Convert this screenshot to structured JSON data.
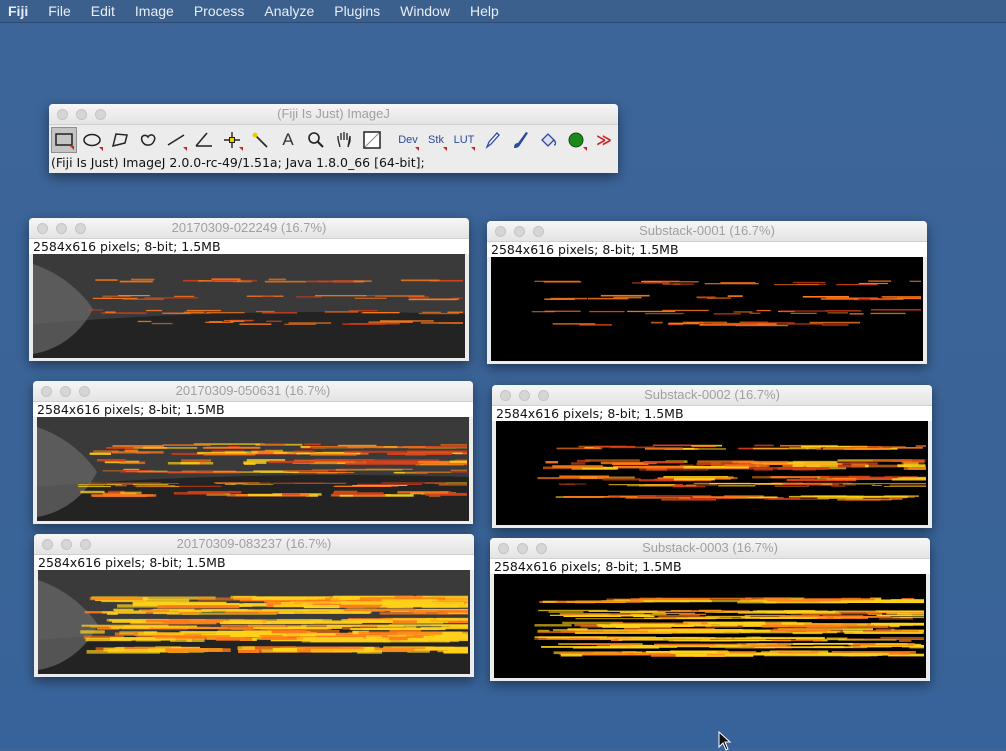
{
  "menubar": {
    "app": "Fiji",
    "items": [
      "File",
      "Edit",
      "Image",
      "Process",
      "Analyze",
      "Plugins",
      "Window",
      "Help"
    ]
  },
  "toolbar": {
    "title": "(Fiji Is Just) ImageJ",
    "status": "(Fiji Is Just) ImageJ 2.0.0-rc-49/1.51a; Java 1.8.0_66 [64-bit];",
    "tools": [
      {
        "name": "rectangle-tool-icon"
      },
      {
        "name": "oval-tool-icon"
      },
      {
        "name": "polygon-tool-icon"
      },
      {
        "name": "freehand-tool-icon"
      },
      {
        "name": "line-tool-icon"
      },
      {
        "name": "angle-tool-icon"
      },
      {
        "name": "point-tool-icon"
      },
      {
        "name": "wand-tool-icon"
      },
      {
        "name": "text-tool-icon",
        "label": "A"
      },
      {
        "name": "magnifier-tool-icon"
      },
      {
        "name": "hand-tool-icon"
      },
      {
        "name": "color-picker-tool-icon"
      },
      {
        "name": "dev-menu-tool",
        "label": "Dev"
      },
      {
        "name": "stacks-menu-tool",
        "label": "Stk"
      },
      {
        "name": "lut-menu-tool",
        "label": "LUT"
      },
      {
        "name": "pencil-tool-icon"
      },
      {
        "name": "brush-tool-icon"
      },
      {
        "name": "flood-fill-tool-icon"
      },
      {
        "name": "green-blob-tool-icon"
      },
      {
        "name": "more-tools-icon",
        "label": "≫"
      }
    ]
  },
  "windows": [
    {
      "id": "w1",
      "title": "20170309-022249 (16.7%)",
      "info": "2584x616 pixels; 8-bit; 1.5MB",
      "kind": "overlay",
      "fill": 0.25
    },
    {
      "id": "w2",
      "title": "20170309-050631 (16.7%)",
      "info": "2584x616 pixels; 8-bit; 1.5MB",
      "kind": "overlay",
      "fill": 0.6
    },
    {
      "id": "w3",
      "title": "20170309-083237 (16.7%)",
      "info": "2584x616 pixels; 8-bit; 1.5MB",
      "kind": "overlay",
      "fill": 0.95
    },
    {
      "id": "s1",
      "title": "Substack-0001 (16.7%)",
      "info": "2584x616 pixels; 8-bit; 1.5MB",
      "kind": "substack",
      "fill": 0.25
    },
    {
      "id": "s2",
      "title": "Substack-0002 (16.7%)",
      "info": "2584x616 pixels; 8-bit; 1.5MB",
      "kind": "substack",
      "fill": 0.6
    },
    {
      "id": "s3",
      "title": "Substack-0003 (16.7%)",
      "info": "2584x616 pixels; 8-bit; 1.5MB",
      "kind": "substack",
      "fill": 0.95
    }
  ],
  "colors": {
    "desktop": "#3a6497",
    "hot_orange": "#ff7a1a",
    "hot_yellow": "#ffd21a",
    "hot_red": "#d8401a"
  }
}
